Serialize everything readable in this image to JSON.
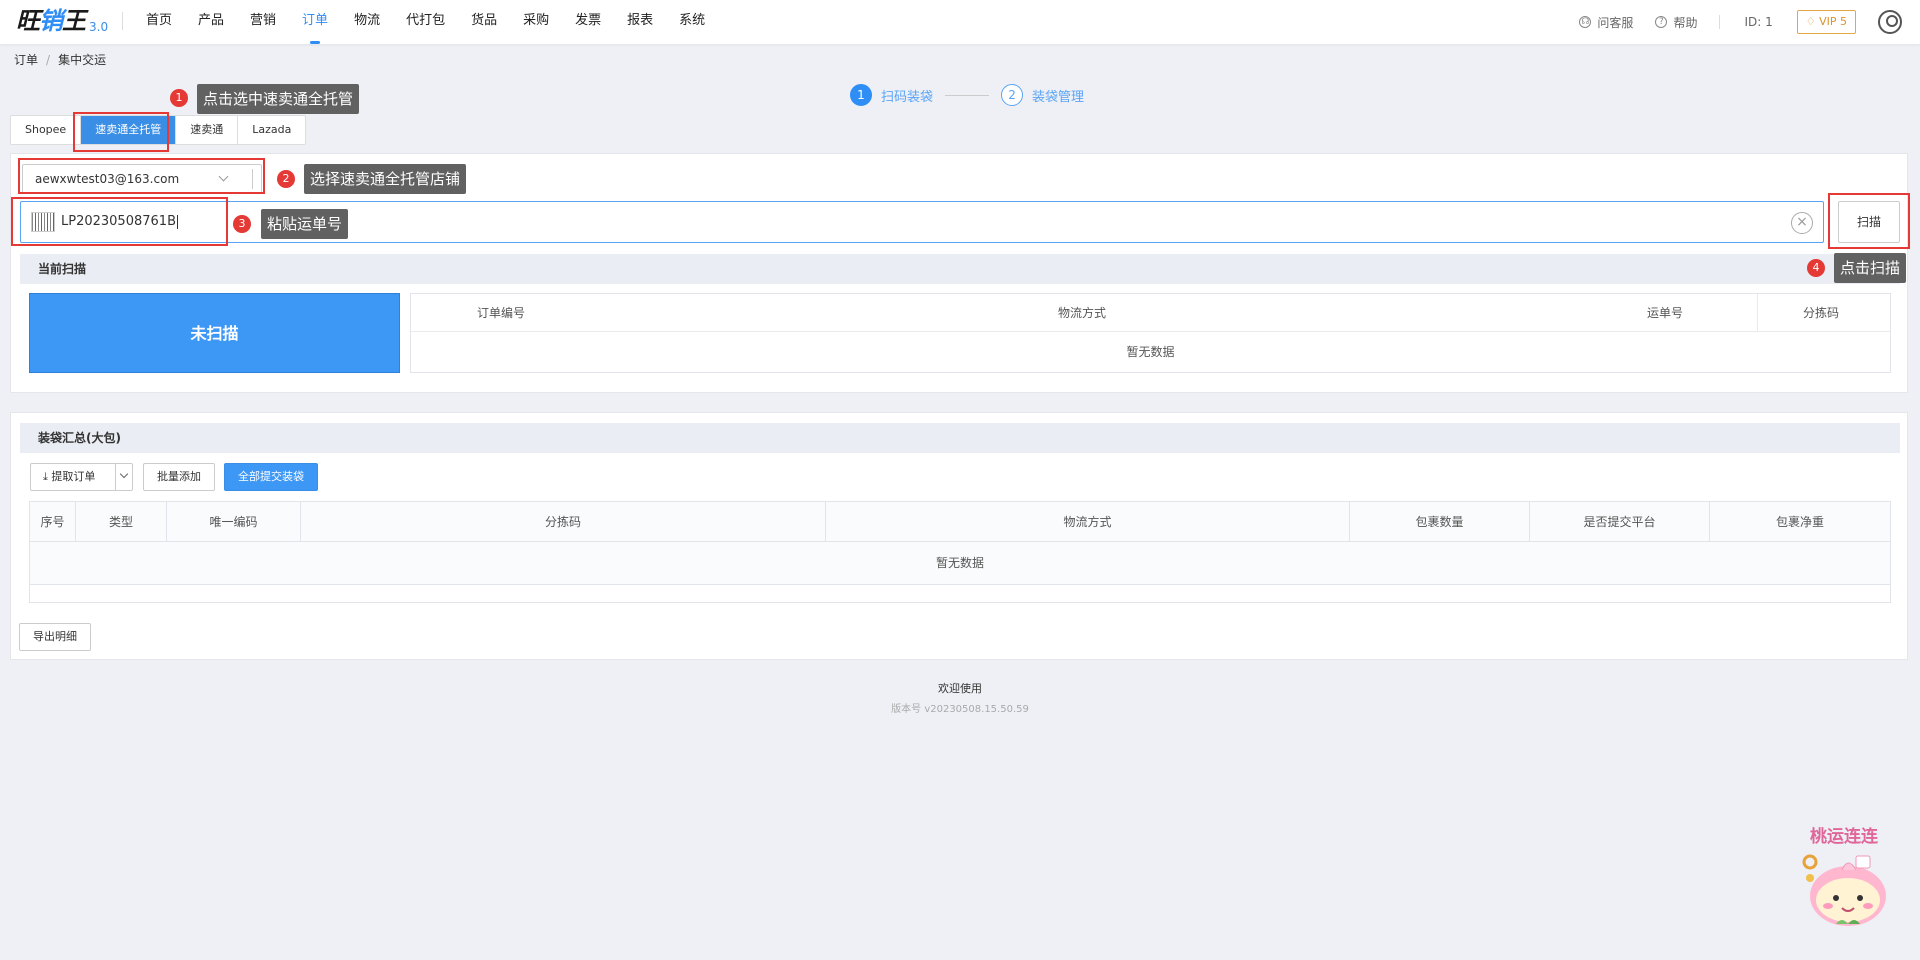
{
  "app": {
    "logo_text": "旺",
    "logo_text2": "销",
    "logo_text3": "王",
    "version": "3.0"
  },
  "nav": [
    "首页",
    "产品",
    "营销",
    "订单",
    "物流",
    "代打包",
    "货品",
    "采购",
    "发票",
    "报表",
    "系统"
  ],
  "nav_active": 3,
  "top_right": {
    "support": "问客服",
    "help": "帮助",
    "user_id": "ID: 1",
    "vip": "VIP 5"
  },
  "breadcrumb": [
    "订单",
    "集中交运"
  ],
  "steps": [
    {
      "num": "1",
      "label": "扫码装袋",
      "active": true
    },
    {
      "num": "2",
      "label": "装袋管理",
      "active": false
    }
  ],
  "platform_tabs": [
    "Shopee",
    "速卖通全托管",
    "速卖通",
    "Lazada"
  ],
  "platform_active": 1,
  "store_select": {
    "value": "aewxwtest03@163.com"
  },
  "scan": {
    "value": "LP20230508761B",
    "button": "扫描"
  },
  "current_scan": {
    "title": "当前扫描",
    "status": "未扫描",
    "columns": [
      "订单编号",
      "物流方式",
      "运单号",
      "分拣码"
    ],
    "empty": "暂无数据"
  },
  "bag_summary": {
    "title": "装袋汇总(大包)",
    "buttons": {
      "fetch": "提取订单",
      "batch_add": "批量添加",
      "submit_all": "全部提交装袋"
    },
    "columns": [
      "序号",
      "类型",
      "唯一编码",
      "分拣码",
      "物流方式",
      "包裹数量",
      "是否提交平台",
      "包裹净重"
    ],
    "empty": "暂无数据",
    "export": "导出明细"
  },
  "footer": {
    "welcome": "欢迎使用",
    "version": "版本号 v20230508.15.50.59"
  },
  "annotations": [
    {
      "num": "1",
      "text": "点击选中速卖通全托管"
    },
    {
      "num": "2",
      "text": "选择速卖通全托管店铺"
    },
    {
      "num": "3",
      "text": "粘贴运单号"
    },
    {
      "num": "4",
      "text": "点击扫描"
    }
  ],
  "mascot": {
    "text": "桃运连连"
  },
  "colors": {
    "primary": "#3d97f5",
    "annotation_red": "#e53935",
    "vip": "#d99330"
  }
}
